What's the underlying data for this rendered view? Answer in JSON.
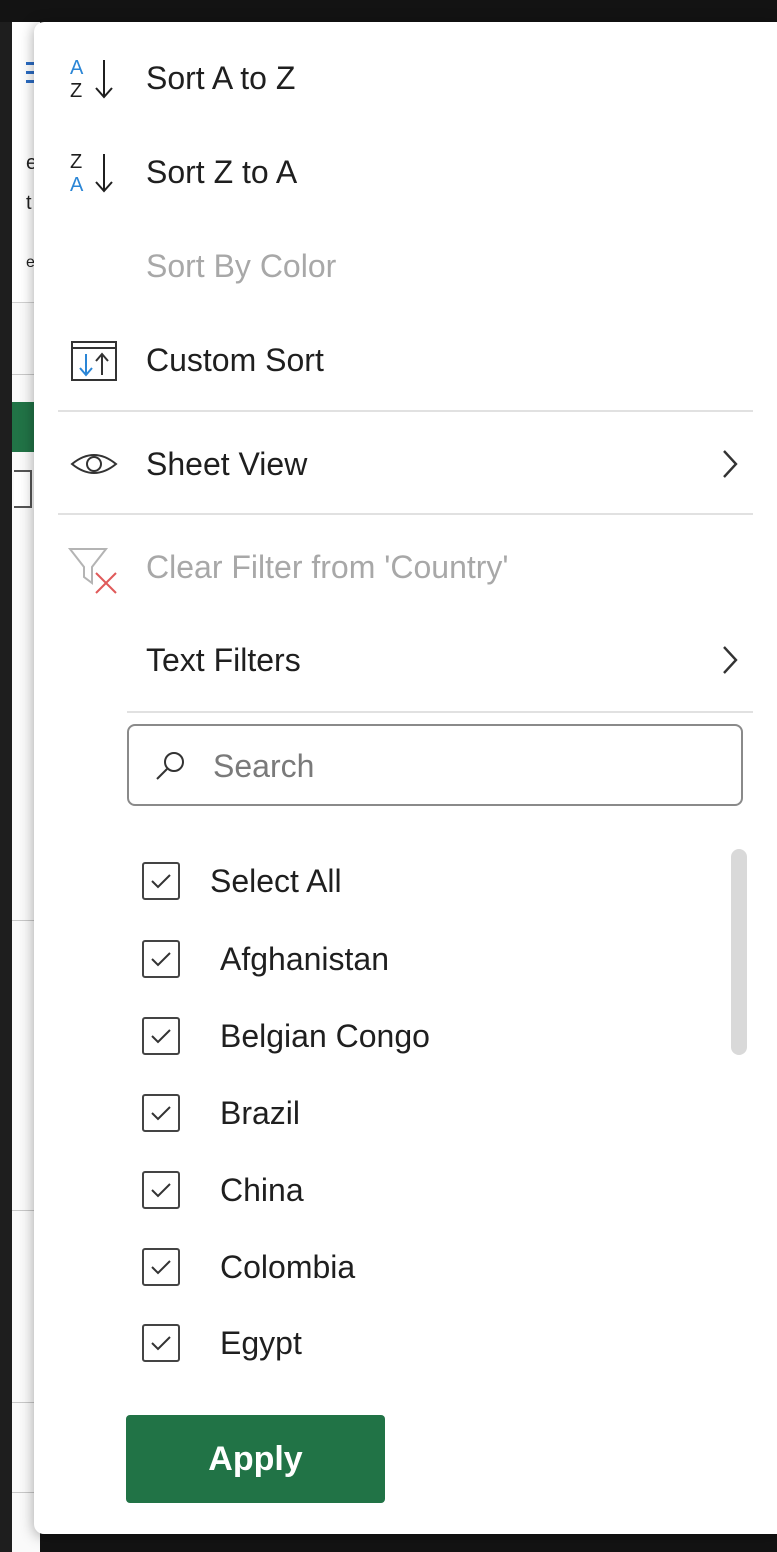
{
  "menu": {
    "sort_az": "Sort A to Z",
    "sort_za": "Sort Z to A",
    "sort_by_color": "Sort By Color",
    "custom_sort": "Custom Sort",
    "sheet_view": "Sheet View",
    "clear_filter": "Clear Filter from 'Country'",
    "text_filters": "Text Filters"
  },
  "icons": {
    "sort_az": "sort-ascending-icon",
    "sort_za": "sort-descending-icon",
    "custom_sort": "custom-sort-icon",
    "sheet_view": "eye-icon",
    "clear_filter": "clear-filter-icon",
    "search": "search-icon",
    "submenu": "chevron-right-icon"
  },
  "search": {
    "placeholder": "Search",
    "value": ""
  },
  "filter_list": {
    "select_all": {
      "label": "Select All",
      "checked": true
    },
    "items": [
      {
        "label": "Afghanistan",
        "checked": true
      },
      {
        "label": "Belgian Congo",
        "checked": true
      },
      {
        "label": "Brazil",
        "checked": true
      },
      {
        "label": "China",
        "checked": true
      },
      {
        "label": "Colombia",
        "checked": true
      },
      {
        "label": "Egypt",
        "checked": true
      }
    ]
  },
  "apply_label": "Apply",
  "background_fragments": [
    "es",
    "t",
    "e"
  ],
  "colors": {
    "accent_green": "#217346",
    "sort_letter_blue": "#2b86d6",
    "clear_filter_red": "#e05a5a",
    "disabled_text": "#a8a8a8"
  }
}
